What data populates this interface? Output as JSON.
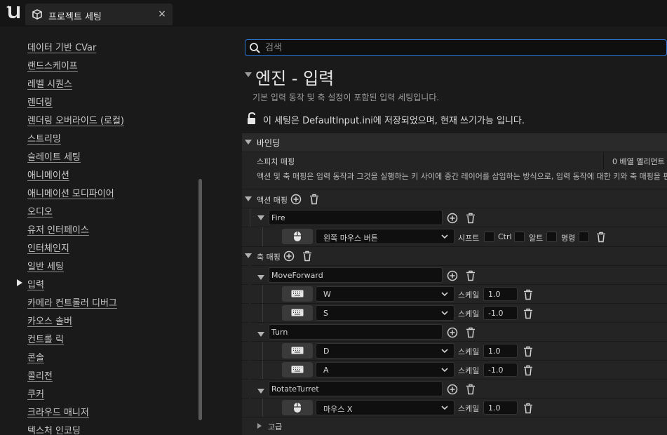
{
  "app": {
    "tab_title": "프로젝트 세팅",
    "close_glyph": "×"
  },
  "sidebar": {
    "items": [
      {
        "label": "데이터 기반 CVar"
      },
      {
        "label": "랜드스케이프"
      },
      {
        "label": "레벨 시퀀스"
      },
      {
        "label": "렌더링"
      },
      {
        "label": "렌더링 오버라이드 (로컬)"
      },
      {
        "label": "스트리밍"
      },
      {
        "label": "슬레이트 세팅"
      },
      {
        "label": "애니메이션"
      },
      {
        "label": "애니메이션 모디파이어"
      },
      {
        "label": "오디오"
      },
      {
        "label": "유저 인터페이스"
      },
      {
        "label": "인터체인지"
      },
      {
        "label": "일반 세팅"
      },
      {
        "label": "입력",
        "selected": true
      },
      {
        "label": "카메라 컨트롤러 디버그"
      },
      {
        "label": "카오스 솔버"
      },
      {
        "label": "컨트롤 릭"
      },
      {
        "label": "콘솔"
      },
      {
        "label": "콜리전"
      },
      {
        "label": "쿠커"
      },
      {
        "label": "크라우드 매니저"
      },
      {
        "label": "텍스처 인코딩"
      }
    ]
  },
  "search": {
    "placeholder": "검색"
  },
  "main": {
    "title": "엔진 - 입력",
    "description": "기본 입력 동작 및 축 설정이 포함된 입력 세팅입니다.",
    "config_note": "이 세팅은 DefaultInput.ini에 저장되었으며, 현재 쓰기가능 입니다."
  },
  "bindings": {
    "header": "바인딩",
    "speech_label": "스피치 매핑",
    "speech_value": "0 배열 엘리먼트",
    "hint": "액션 및 축 매핑은 입력 동작과 그것을 실행하는 키 사이에 중간 레이어를 삽입하는 방식으로, 입력 동작에 대한 키와 축 매핑을 편하게",
    "action_label": "액션 매핑",
    "axis_label": "축 매핑",
    "advanced_label": "고급",
    "actions": [
      {
        "name": "Fire",
        "key": "왼쪽 마우스 버튼",
        "mod_shift": "시프트",
        "mod_ctrl": "Ctrl",
        "mod_alt": "알트",
        "mod_cmd": "명령"
      }
    ],
    "axes": [
      {
        "name": "MoveForward",
        "keys": [
          {
            "key": "W",
            "scale": "1.0"
          },
          {
            "key": "S",
            "scale": "-1.0"
          }
        ]
      },
      {
        "name": "Turn",
        "keys": [
          {
            "key": "D",
            "scale": "1.0"
          },
          {
            "key": "A",
            "scale": "-1.0"
          }
        ]
      },
      {
        "name": "RotateTurret",
        "keys": [
          {
            "key": "마우스 X",
            "scale": "1.0"
          }
        ]
      }
    ],
    "scale_label": "스케일"
  },
  "colors": {
    "accent": "#2a77d8",
    "background": "#1a1a1a",
    "row": "#242424"
  }
}
